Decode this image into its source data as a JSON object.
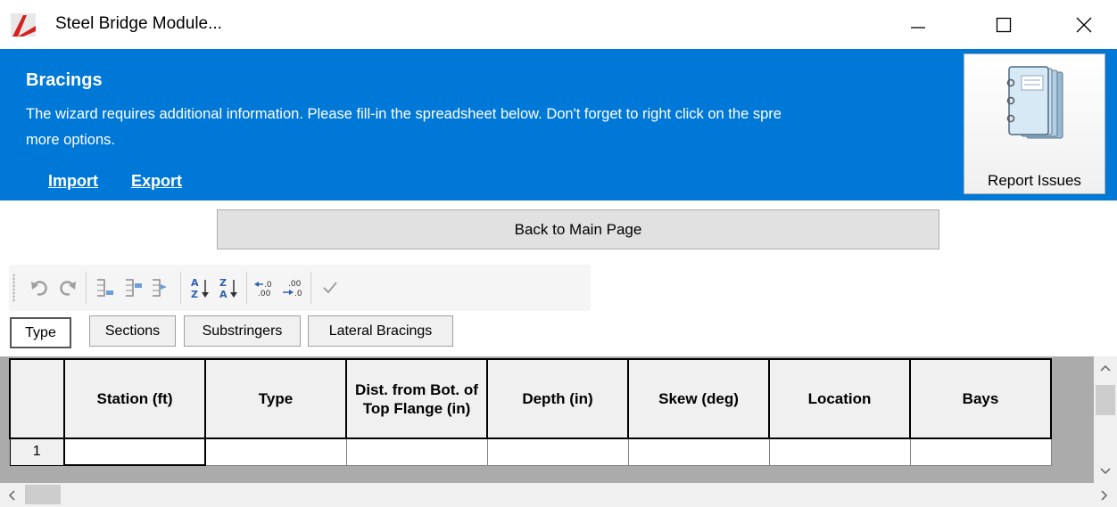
{
  "window": {
    "title": "Steel Bridge Module..."
  },
  "header": {
    "title": "Bracings",
    "description": "The wizard requires additional information. Please fill-in the spreadsheet below. Don't forget to right click on the spre",
    "description_cont": "more options.",
    "links": {
      "import": "Import",
      "export": "Export"
    },
    "report_label": "Report Issues",
    "bg_color": "#0078d7"
  },
  "back_button": {
    "label": "Back to Main Page"
  },
  "tabs": [
    {
      "label": "Type",
      "active": true
    },
    {
      "label": "Sections",
      "active": false
    },
    {
      "label": "Substringers",
      "active": false
    },
    {
      "label": "Lateral Bracings",
      "active": false
    }
  ],
  "grid": {
    "columns": [
      "Station (ft)",
      "Type",
      "Dist. from Bot. of Top Flange (in)",
      "Depth (in)",
      "Skew (deg)",
      "Location",
      "Bays"
    ],
    "rows": [
      {
        "num": "1",
        "cells": [
          "",
          "",
          "",
          "",
          "",
          "",
          ""
        ]
      }
    ]
  },
  "toolbar_icons": [
    "undo-icon",
    "redo-icon",
    "insert-row-icon",
    "append-row-icon",
    "delete-row-icon",
    "sort-ascending-icon",
    "sort-descending-icon",
    "decrease-decimals-icon",
    "increase-decimals-icon",
    "validate-icon"
  ]
}
